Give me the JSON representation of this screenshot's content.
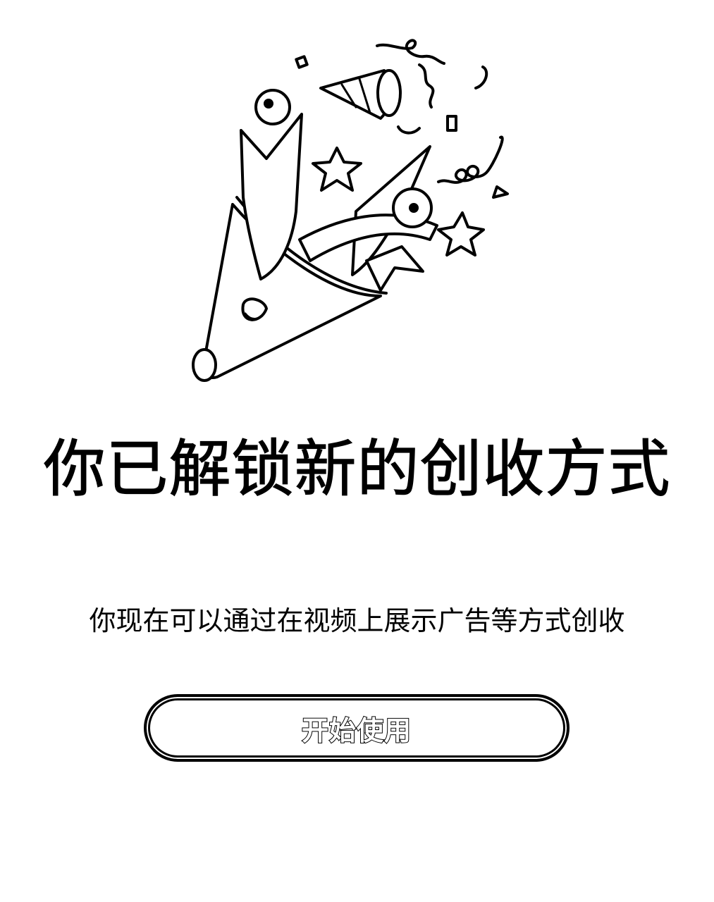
{
  "dialog": {
    "title": "你已解锁新的创收方式",
    "subtitle": "你现在可以通过在视频上展示广告等方式创收",
    "primary_button_label": "开始使用",
    "illustration_icon": "party-popper-icon"
  },
  "colors": {
    "background": "#ffffff",
    "ink": "#000000"
  }
}
